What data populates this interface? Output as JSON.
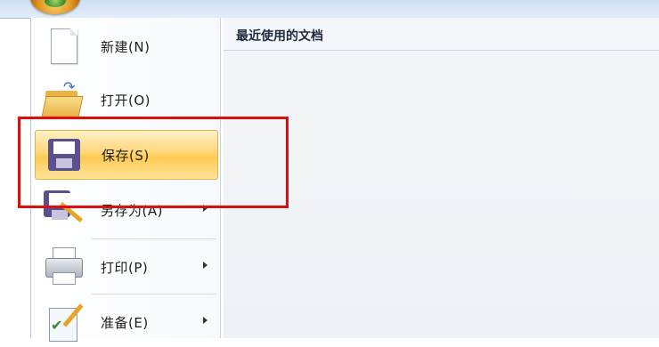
{
  "menu": {
    "items": [
      {
        "label": "新建(N)",
        "icon": "new-document-icon"
      },
      {
        "label": "打开(O)",
        "icon": "open-folder-icon"
      },
      {
        "label": "保存(S)",
        "icon": "save-floppy-icon",
        "selected": true
      },
      {
        "label": "另存为(A)",
        "icon": "save-as-icon",
        "has_submenu": true
      },
      {
        "label": "打印(P)",
        "icon": "printer-icon",
        "has_submenu": true
      },
      {
        "label": "准备(E)",
        "icon": "prepare-icon",
        "has_submenu": true
      }
    ]
  },
  "recent": {
    "title": "最近使用的文档"
  },
  "colors": {
    "highlight_box": "#e10c0c",
    "selected_item": "#ffd77a"
  }
}
